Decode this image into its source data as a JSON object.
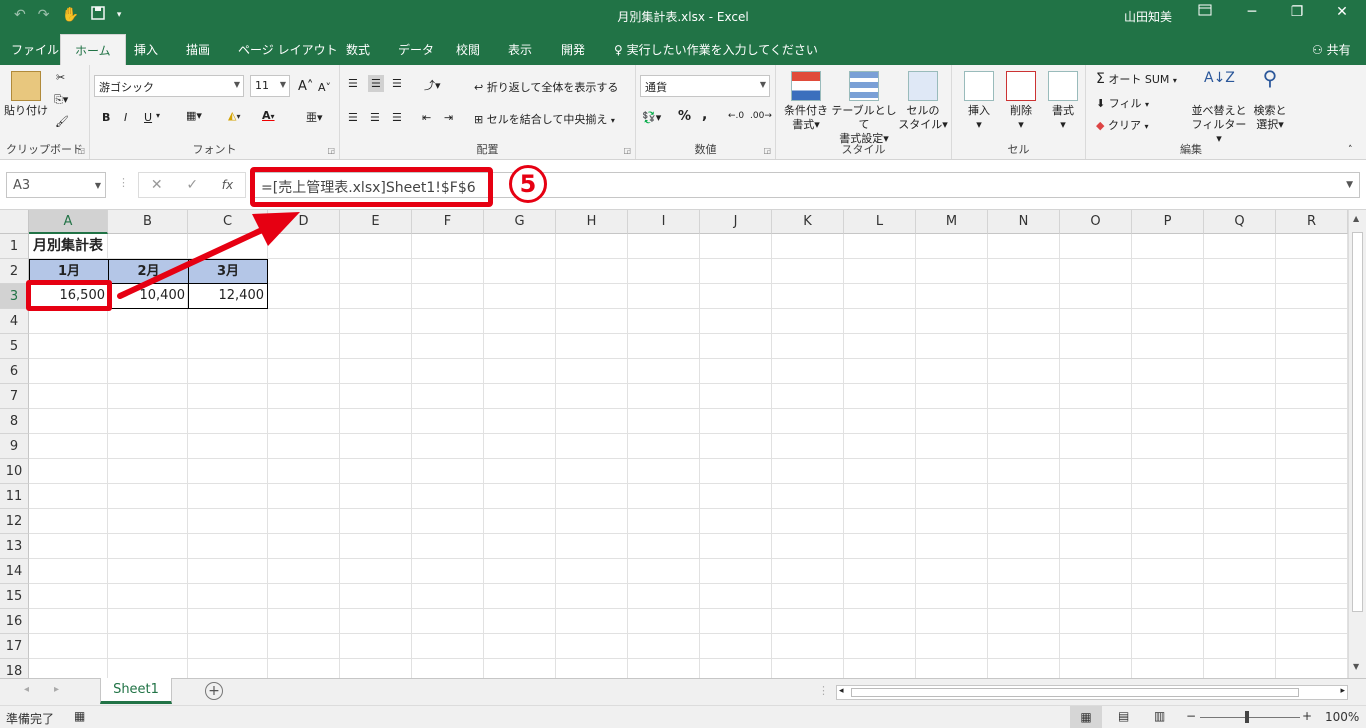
{
  "titlebar": {
    "title": "月別集計表.xlsx - Excel",
    "user": "山田知美",
    "restore_icon": "ribbon-display-icon",
    "min": "─",
    "max": "❐",
    "close": "✕"
  },
  "tabs": [
    "ファイル",
    "ホーム",
    "挿入",
    "描画",
    "ページ レイアウト",
    "数式",
    "データ",
    "校閲",
    "表示",
    "開発"
  ],
  "tellme": "実行したい作業を入力してください",
  "share": "共有",
  "ribbon": {
    "clipboard": {
      "paste": "貼り付け",
      "label": "クリップボード"
    },
    "font": {
      "name": "游ゴシック",
      "size": "11",
      "label": "フォント",
      "bold": "B",
      "italic": "I",
      "underline": "U",
      "grow": "A",
      "shrink": "A",
      "color": "A"
    },
    "align": {
      "wrap": "折り返して全体を表示する",
      "merge": "セルを結合して中央揃え",
      "label": "配置"
    },
    "number": {
      "format": "通貨",
      "percent": "%",
      "comma": ",",
      "label": "数値"
    },
    "styles": {
      "cond1": "条件付き",
      "cond2": "書式",
      "table1": "テーブルとして",
      "table2": "書式設定",
      "cell1": "セルの",
      "cell2": "スタイル",
      "label": "スタイル"
    },
    "cells": {
      "insert": "挿入",
      "delete": "削除",
      "format": "書式",
      "label": "セル"
    },
    "editing": {
      "sum": "オート SUM",
      "fill": "フィル",
      "clear": "クリア",
      "sort1": "並べ替えと",
      "sort2": "フィルター",
      "find1": "検索と",
      "find2": "選択",
      "label": "編集"
    }
  },
  "formula_bar": {
    "name_box": "A3",
    "cancel": "✕",
    "enter": "✓",
    "fx": "fx",
    "formula": "=[売上管理表.xlsx]Sheet1!$F$6"
  },
  "annotation": {
    "badge": "5"
  },
  "columns": [
    "A",
    "B",
    "C",
    "D",
    "E",
    "F",
    "G",
    "H",
    "I",
    "J",
    "K",
    "L",
    "M",
    "N",
    "O",
    "P",
    "Q",
    "R"
  ],
  "rows": [
    "1",
    "2",
    "3",
    "4",
    "5",
    "6",
    "7",
    "8",
    "9",
    "10",
    "11",
    "12",
    "13",
    "14",
    "15",
    "16",
    "17",
    "18"
  ],
  "cells": {
    "A1": "月別集計表",
    "A2": "1月",
    "B2": "2月",
    "C2": "3月",
    "A3": "16,500",
    "B3": "10,400",
    "C3": "12,400"
  },
  "header_fill": "#b4c6e7",
  "sheet_tab": "Sheet1",
  "status": {
    "ready": "準備完了",
    "zoom": "100%"
  }
}
